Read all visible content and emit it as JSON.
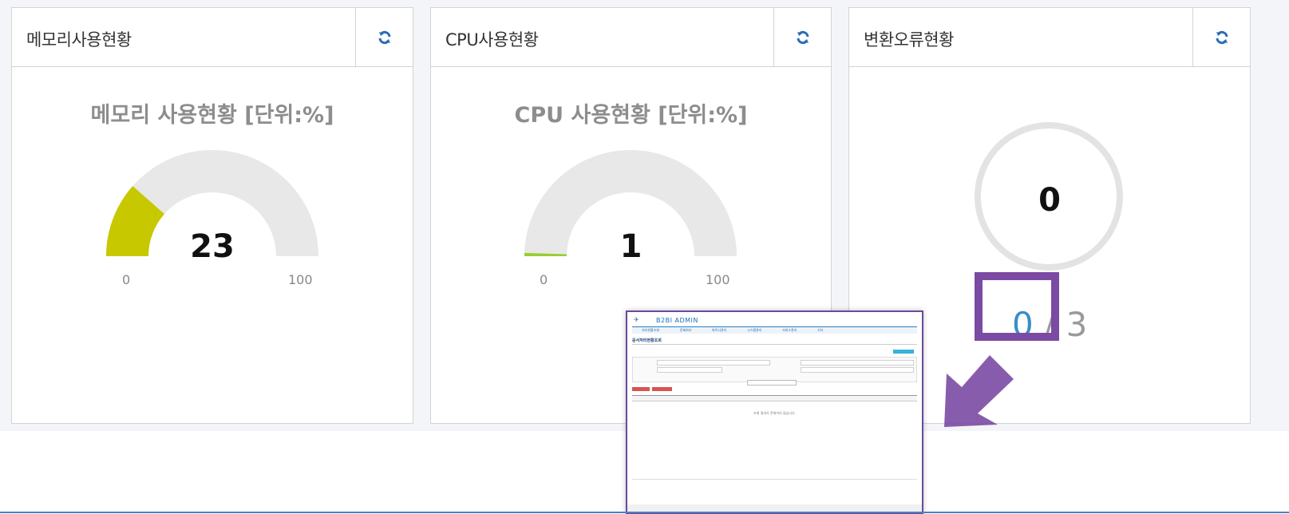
{
  "panels": {
    "memory": {
      "header": "메모리사용현황",
      "chart_title": "메모리 사용현황 [단위:%]",
      "value": "23",
      "min_label": "0",
      "max_label": "100"
    },
    "cpu": {
      "header": "CPU사용현황",
      "chart_title": "CPU 사용현황 [단위:%]",
      "value": "1",
      "min_label": "0",
      "max_label": "100"
    },
    "error": {
      "header": "변환오류현황",
      "value": "0",
      "current": "0",
      "separator": " / ",
      "total": "3"
    }
  },
  "chart_data": [
    {
      "type": "gauge",
      "title": "메모리 사용현황 [단위:%]",
      "value": 23,
      "ylim": [
        0,
        100
      ],
      "color": "#c8c800",
      "track_color": "#e8e8e8"
    },
    {
      "type": "gauge",
      "title": "CPU 사용현황 [단위:%]",
      "value": 1,
      "ylim": [
        0,
        100
      ],
      "color": "#9acd32",
      "track_color": "#e8e8e8"
    },
    {
      "type": "donut",
      "title": "",
      "value": 0,
      "ring_color": "#e3e3e3"
    }
  ],
  "colors": {
    "highlight": "#7b4aa3",
    "arrow": "#7b4aa3",
    "refresh_icon": "#2a6db5"
  },
  "icons": {
    "refresh": "refresh-icon",
    "arrow": "arrow-down-left-icon"
  },
  "thumbnail": {
    "brand": "B2BI ADMIN",
    "nav": [
      "처리현황조회",
      "문제처리",
      "파트너관리",
      "시스템관리",
      "서비스관리",
      "기타"
    ],
    "page_title": "문서처리현황조회",
    "empty_message": "조회 결과가 존재하지 않습니다."
  }
}
